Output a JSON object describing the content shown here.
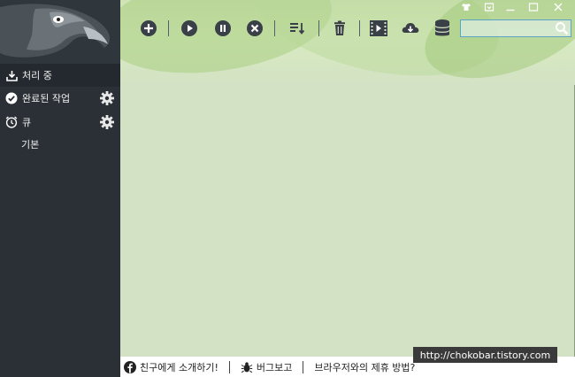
{
  "sidebar": {
    "items": [
      {
        "label": "처리 중",
        "icon": "download-tray-icon",
        "active": true
      },
      {
        "label": "완료된 작업",
        "icon": "check-circle-icon",
        "has_settings": true
      },
      {
        "label": "큐",
        "icon": "alarm-clock-icon",
        "has_settings": true
      },
      {
        "label": "기본",
        "sub": true
      }
    ]
  },
  "toolbar": {
    "buttons": [
      "add-icon",
      "play-icon",
      "pause-icon",
      "stop-icon",
      "sort-icon",
      "trash-icon",
      "video-icon",
      "cloud-download-icon",
      "database-icon"
    ]
  },
  "search": {
    "value": "",
    "placeholder": ""
  },
  "status": {
    "share_label": "친구에게 소개하기!",
    "bug_label": "버그보고",
    "browser_label": "브라우저와의 제휴 방법?"
  },
  "watermark": "http://chokobar.tistory.com",
  "colors": {
    "sidebar": "#2a3036",
    "content": "#d3e2c4",
    "search_border": "#5aa4c8"
  }
}
